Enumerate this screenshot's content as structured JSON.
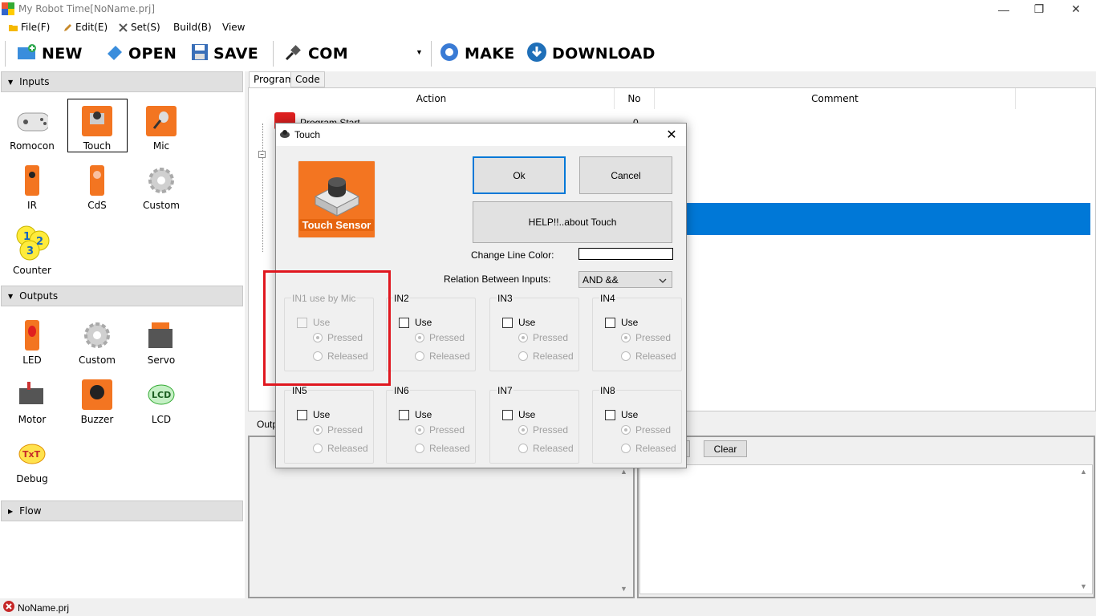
{
  "window": {
    "title": "My Robot Time[NoName.prj]",
    "minimize_glyph": "—",
    "restore_glyph": "❐",
    "close_glyph": "✕"
  },
  "menu": [
    {
      "label": "File(F)",
      "icon": "folder-icon"
    },
    {
      "label": "Edit(E)",
      "icon": "edit-icon"
    },
    {
      "label": "Set(S)",
      "icon": "tools-icon"
    },
    {
      "label": "Build(B)",
      "icon": ""
    },
    {
      "label": "View",
      "icon": ""
    }
  ],
  "toolbar": {
    "new_label": "NEW",
    "open_label": "OPEN",
    "save_label": "SAVE",
    "com_label": "COM",
    "com_value": "",
    "make_label": "MAKE",
    "download_label": "DOWNLOAD"
  },
  "left_panel": {
    "inputs_header": "Inputs",
    "inputs": [
      "Romocon",
      "Touch",
      "Mic",
      "IR",
      "CdS",
      "Custom",
      "Counter"
    ],
    "outputs_header": "Outputs",
    "outputs": [
      "LED",
      "Custom",
      "Servo",
      "Motor",
      "Buzzer",
      "LCD",
      "Debug"
    ],
    "flow_header": "Flow",
    "selected_input": "Touch"
  },
  "tabs": [
    "Program",
    "Code"
  ],
  "program": {
    "columns": [
      "Action",
      "No",
      "Comment"
    ],
    "rows": [
      {
        "action": "Program Start",
        "no": "0"
      }
    ]
  },
  "bottom": {
    "output_label": "Outp",
    "clear_label": "Clear"
  },
  "status": {
    "file": "NoName.prj"
  },
  "dialog": {
    "title": "Touch",
    "image_label": "Touch Sensor",
    "ok_label": "Ok",
    "cancel_label": "Cancel",
    "help_label": "HELP!!..about Touch",
    "color_label": "Change Line Color:",
    "relation_label": "Relation Between Inputs:",
    "relation_value": "AND &&",
    "groups": [
      {
        "title": "IN1 use by Mic",
        "use": "Use",
        "pressed": "Pressed",
        "released": "Released",
        "disabled": true
      },
      {
        "title": "IN2",
        "use": "Use",
        "pressed": "Pressed",
        "released": "Released",
        "disabled": false
      },
      {
        "title": "IN3",
        "use": "Use",
        "pressed": "Pressed",
        "released": "Released",
        "disabled": false
      },
      {
        "title": "IN4",
        "use": "Use",
        "pressed": "Pressed",
        "released": "Released",
        "disabled": false
      },
      {
        "title": "IN5",
        "use": "Use",
        "pressed": "Pressed",
        "released": "Released",
        "disabled": false
      },
      {
        "title": "IN6",
        "use": "Use",
        "pressed": "Pressed",
        "released": "Released",
        "disabled": false
      },
      {
        "title": "IN7",
        "use": "Use",
        "pressed": "Pressed",
        "released": "Released",
        "disabled": false
      },
      {
        "title": "IN8",
        "use": "Use",
        "pressed": "Pressed",
        "released": "Released",
        "disabled": false
      }
    ]
  },
  "colors": {
    "selection": "#0078d7",
    "highlight": "#e0171f",
    "sensor_orange": "#f37521"
  }
}
